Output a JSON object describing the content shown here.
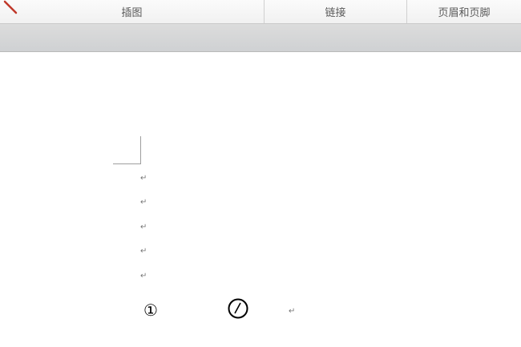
{
  "ribbon": {
    "groups": [
      {
        "label": "插图"
      },
      {
        "label": "链接"
      },
      {
        "label": "页眉和页脚"
      }
    ]
  },
  "document": {
    "paragraph_mark": "↵",
    "circled_one": "①",
    "circled_slash_icon": "circle-slash-icon"
  }
}
